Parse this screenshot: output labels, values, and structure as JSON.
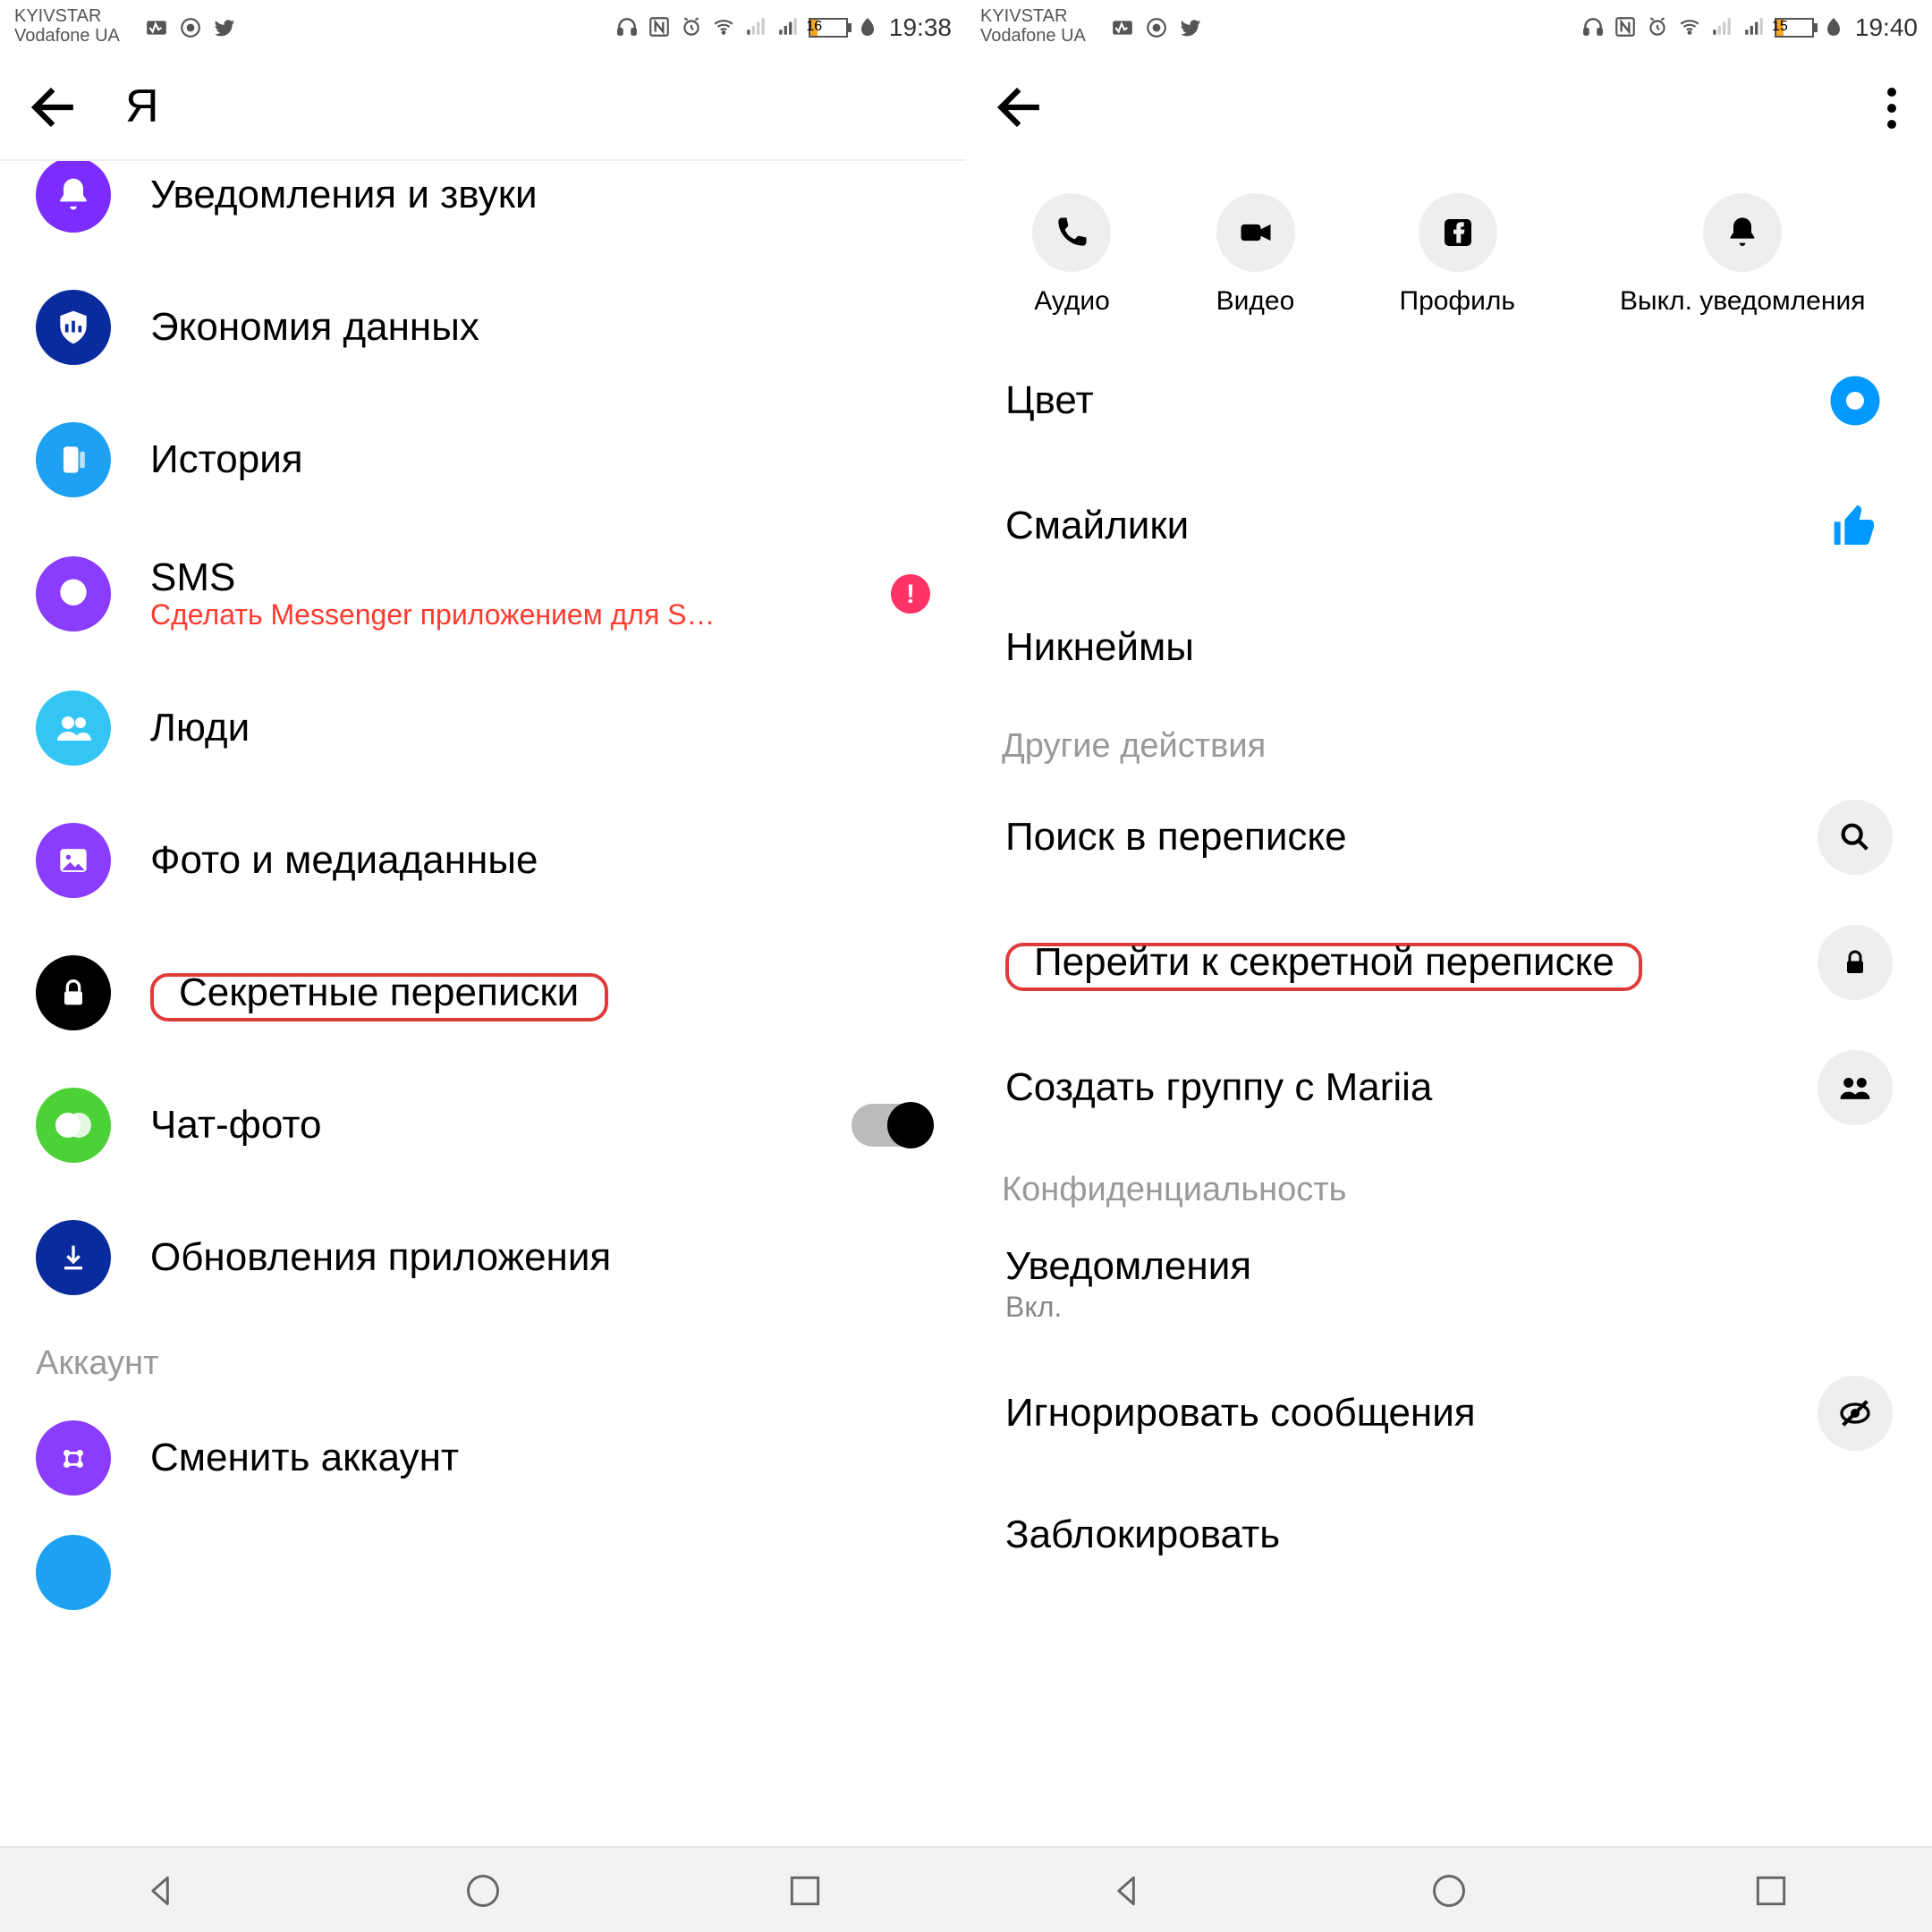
{
  "left": {
    "status": {
      "carrier1": "KYIVSTAR",
      "carrier2": "Vodafone UA",
      "battery": "16",
      "time": "19:38"
    },
    "header": {
      "title": "Я"
    },
    "items": {
      "notifications": "Уведомления и звуки",
      "data": "Экономия данных",
      "history": "История",
      "sms": "SMS",
      "sms_sub": "Сделать Messenger приложением для S…",
      "people": "Люди",
      "photos": "Фото и медиаданные",
      "secret": "Секретные переписки",
      "chatphoto": "Чат-фото",
      "updates": "Обновления приложения",
      "section_account": "Аккаунт",
      "switch": "Сменить аккаунт"
    }
  },
  "right": {
    "status": {
      "carrier1": "KYIVSTAR",
      "carrier2": "Vodafone UA",
      "battery": "15",
      "time": "19:40"
    },
    "actions": {
      "audio": "Аудио",
      "video": "Видео",
      "profile": "Профиль",
      "mute": "Выкл. уведомления"
    },
    "items": {
      "color": "Цвет",
      "emoji": "Смайлики",
      "nicknames": "Никнеймы",
      "section_other": "Другие действия",
      "search": "Поиск в переписке",
      "secret": "Перейти к секретной переписке",
      "group": "Создать группу с Mariia",
      "section_privacy": "Конфиденциальность",
      "notif": "Уведомления",
      "notif_sub": "Вкл.",
      "ignore": "Игнорировать сообщения",
      "block": "Заблокировать"
    }
  }
}
